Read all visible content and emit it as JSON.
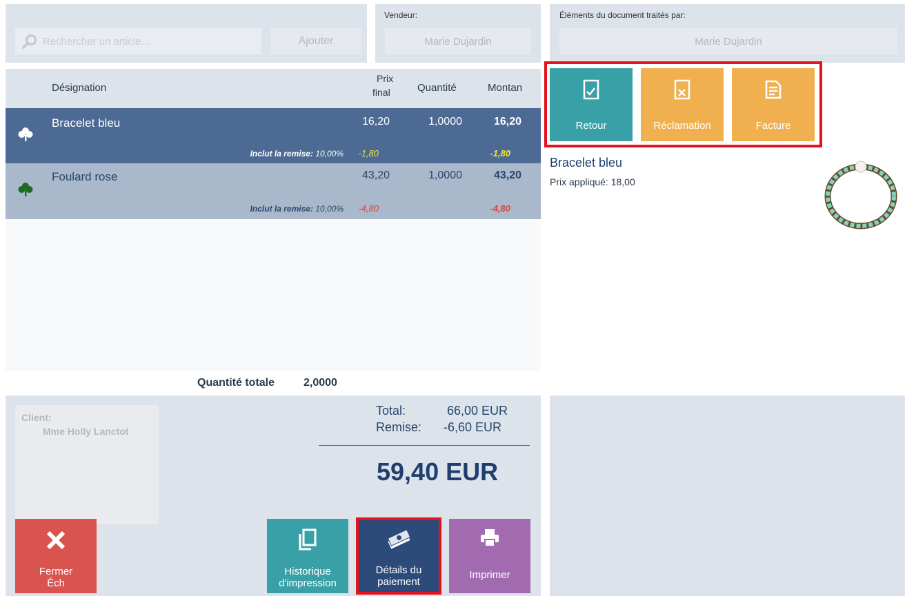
{
  "search": {
    "placeholder": "Rechercher un article..."
  },
  "add_button": "Ajouter",
  "vendor": {
    "label": "Vendeur:",
    "value": "Marie Dujardin"
  },
  "processed_by": {
    "label": "Éléments du document traités par:",
    "value": "Marie Dujardin"
  },
  "table": {
    "headers": {
      "designation": "Désignation",
      "price_line1": "Prix",
      "price_line2": "final",
      "quantity": "Quantité",
      "amount": "Montan"
    },
    "rows": [
      {
        "name": "Bracelet bleu",
        "price": "16,20",
        "qty": "1,0000",
        "amount": "16,20",
        "discount_label": "Inclut la remise:",
        "discount_pct": "10,00%",
        "discount_price": "-1,80",
        "discount_amount": "-1,80",
        "icon": "clover-icon"
      },
      {
        "name": "Foulard rose",
        "price": "43,20",
        "qty": "1,0000",
        "amount": "43,20",
        "discount_label": "Inclut la remise:",
        "discount_pct": "10,00%",
        "discount_price": "-4,80",
        "discount_amount": "-4,80",
        "icon": "clover-icon"
      }
    ]
  },
  "total_quantity": {
    "label": "Quantité totale",
    "value": "2,0000"
  },
  "client": {
    "label": "Client:",
    "name": "Mme Holly Lanctot"
  },
  "totals": {
    "total_label": "Total:",
    "total_value": "66,00 EUR",
    "discount_label": "Remise:",
    "discount_value": "-6,60 EUR",
    "grand_total": "59,40 EUR"
  },
  "actions": {
    "close": {
      "line1": "Fermer",
      "line2": "Éch"
    },
    "history": {
      "line1": "Historique",
      "line2": "d'impression"
    },
    "payment": {
      "line1": "Détails du",
      "line2": "paiement"
    },
    "print": {
      "label": "Imprimer"
    }
  },
  "doc_buttons": {
    "retour": "Retour",
    "reclamation": "Réclamation",
    "facture": "Facture"
  },
  "detail": {
    "title": "Bracelet bleu",
    "price_label": "Prix appliqué:",
    "price_value": "18,00"
  },
  "colors": {
    "selected_row": "#4c6a93",
    "second_row": "#a9b8cb",
    "teal": "#3aa0a8",
    "orange": "#f0b050",
    "red": "#d9534f",
    "navy": "#2c4a7a",
    "purple": "#a26bb0",
    "highlight": "#e3121d"
  }
}
